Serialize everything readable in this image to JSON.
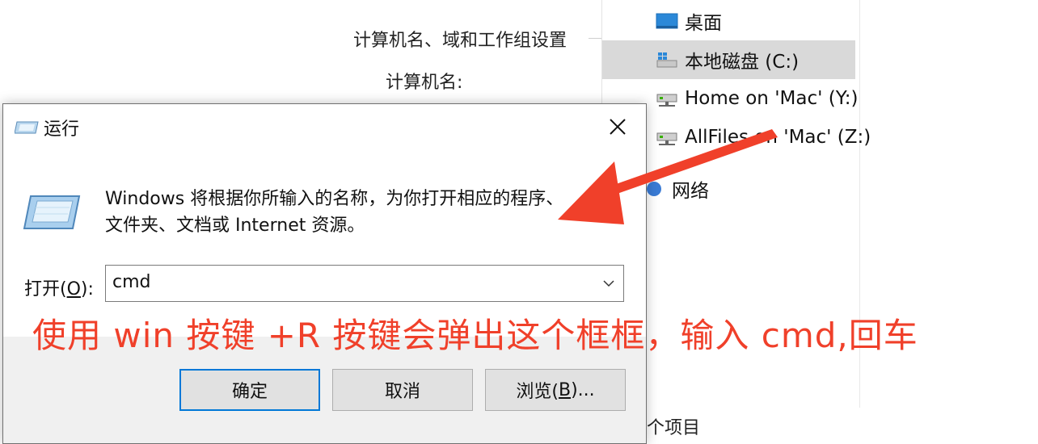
{
  "background": {
    "section_title": "计算机名、域和工作组设置",
    "computer_name_label": "计算机名:",
    "footer_text": "个项目"
  },
  "nav_pane": {
    "items": [
      {
        "label": "桌面",
        "icon": "desktop-icon"
      },
      {
        "label": "本地磁盘 (C:)",
        "icon": "local-disk-icon",
        "selected": true
      },
      {
        "label": "Home on 'Mac' (Y:)",
        "icon": "network-drive-icon"
      },
      {
        "label": "AllFiles on 'Mac' (Z:)",
        "icon": "network-drive-icon"
      },
      {
        "label": "网络",
        "icon": "network-icon"
      }
    ]
  },
  "run_dialog": {
    "title": "运行",
    "description_line1": "Windows 将根据你所输入的名称，为你打开相应的程序、",
    "description_line2": "文件夹、文档或 Internet 资源。",
    "open_label_prefix": "打开(",
    "open_label_key": "O",
    "open_label_suffix": "):",
    "input_value": "cmd",
    "ok_label": "确定",
    "cancel_label": "取消",
    "browse_label_prefix": "浏览(",
    "browse_label_key": "B",
    "browse_label_suffix": ")..."
  },
  "annotation": {
    "text": "使用 win 按键 +R 按键会弹出这个框框，输入 cmd,回车",
    "color": "#f0402a"
  }
}
